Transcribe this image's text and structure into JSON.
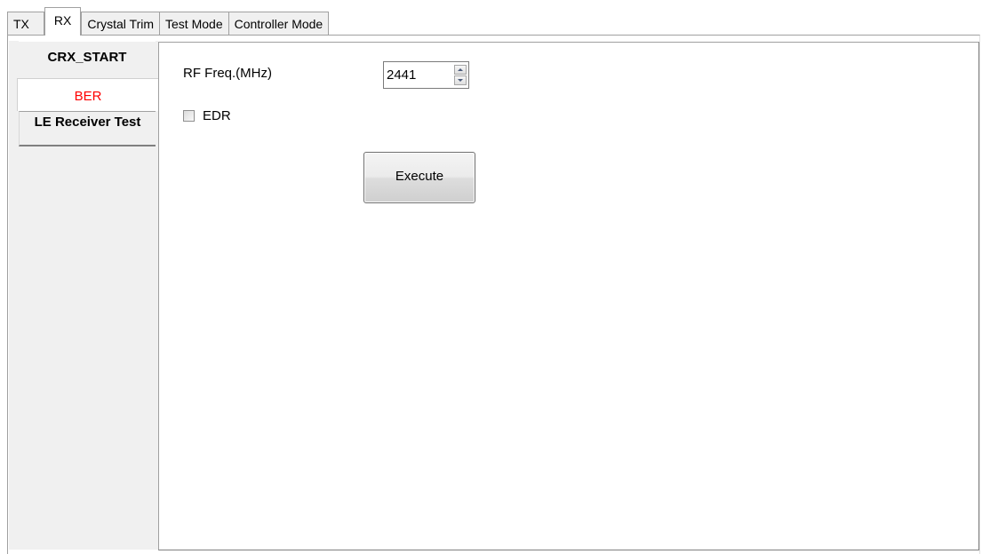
{
  "top_tabs": [
    {
      "label": "TX"
    },
    {
      "label": "RX"
    },
    {
      "label": "Crystal Trim"
    },
    {
      "label": "Test Mode"
    },
    {
      "label": "Controller Mode"
    }
  ],
  "selected_top_tab": "RX",
  "side_tabs": [
    {
      "label": "CRX_START"
    },
    {
      "label": "BER",
      "color": "#ff0000"
    },
    {
      "label": "LE Receiver Test"
    }
  ],
  "selected_side_tab": "BER",
  "form": {
    "rf_freq_label": "RF Freq.(MHz)",
    "rf_freq_value": "2441",
    "edr_label": "EDR",
    "edr_checked": false,
    "execute_label": "Execute"
  }
}
